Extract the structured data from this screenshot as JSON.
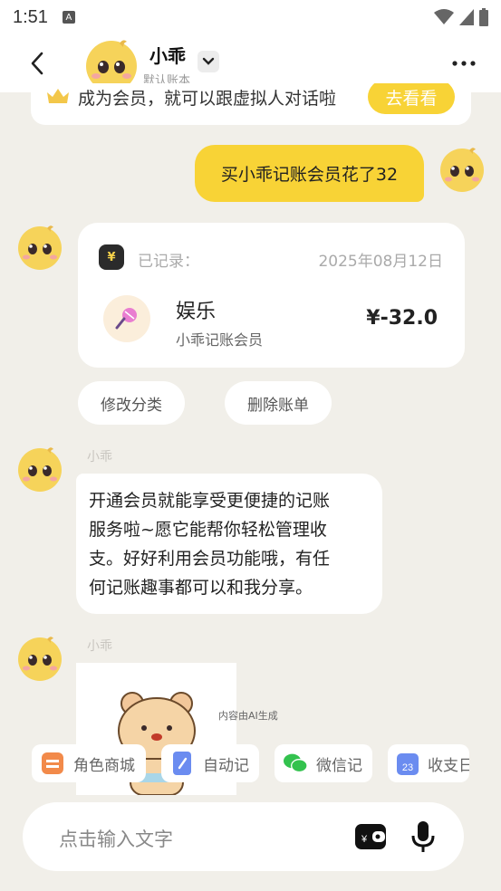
{
  "status_bar": {
    "time": "1:51",
    "badge": "A"
  },
  "header": {
    "title": "小乖",
    "subtitle": "默认账本"
  },
  "banner": {
    "text": "成为会员，就可以跟虚拟人对话啦",
    "button": "去看看"
  },
  "user_message": {
    "text": "买小乖记账会员花了32"
  },
  "record": {
    "icon_symbol": "¥",
    "label": "已记录：",
    "date": "2025年08月12日",
    "category": "娱乐",
    "note": "小乖记账会员",
    "amount": "¥-32.0"
  },
  "actions": {
    "edit_category": "修改分类",
    "delete_bill": "删除账单"
  },
  "bot": {
    "name": "小乖",
    "reply_lines": [
      "开通会员就能享受更便捷的记账",
      "服务啦~愿它能帮你轻松管理收",
      "支。好好利用会员功能哦，有任",
      "何记账趣事都可以和我分享。"
    ],
    "ai_note": "内容由AI生成"
  },
  "quick_bar": [
    {
      "label": "角色商城",
      "icon": "store-icon",
      "color": "#f28a4a"
    },
    {
      "label": "自动记",
      "icon": "notebook-icon",
      "color": "#6b8cf0"
    },
    {
      "label": "微信记",
      "icon": "wechat-icon",
      "color": "#33c24e"
    },
    {
      "label": "收支日历",
      "icon": "calendar-icon",
      "color": "#6b8cf0",
      "calendar_day": "23"
    }
  ],
  "input": {
    "placeholder": "点击输入文字"
  },
  "colors": {
    "accent": "#f8d336",
    "background": "#f1efe9"
  }
}
